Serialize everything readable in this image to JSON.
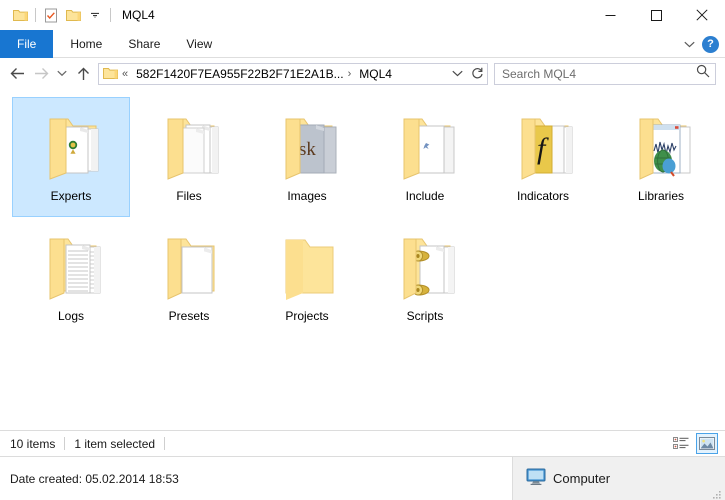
{
  "window": {
    "title": "MQL4",
    "quick_access": [
      {
        "name": "folder-icon",
        "label": "Folder"
      },
      {
        "name": "properties-icon",
        "label": "Properties"
      },
      {
        "name": "new-folder-icon",
        "label": "New folder"
      },
      {
        "name": "chevron-down-icon",
        "label": "Customize Quick Access Toolbar"
      }
    ],
    "controls": {
      "minimize": "—",
      "maximize": "□",
      "close": "✕"
    }
  },
  "ribbon": {
    "tabs": [
      {
        "label": "File",
        "active": true
      },
      {
        "label": "Home",
        "active": false
      },
      {
        "label": "Share",
        "active": false
      },
      {
        "label": "View",
        "active": false
      }
    ],
    "expand_label": "∨",
    "help_label": "?"
  },
  "address": {
    "back_label": "Back",
    "forward_label": "Forward",
    "recent_label": "Recent locations",
    "up_label": "Up",
    "crumb_overflow": "«",
    "crumb_parent": "582F1420F7EA955F22B2F71E2A1B...",
    "crumb_separator": "›",
    "crumb_current": "MQL4",
    "dropdown_label": "∨",
    "refresh_label": "↻"
  },
  "search": {
    "placeholder": "Search MQL4",
    "icon": "search-icon"
  },
  "files": [
    {
      "name": "Experts",
      "icon": "folder-open-emblem",
      "selected": true
    },
    {
      "name": "Files",
      "icon": "folder-open-papers",
      "selected": false
    },
    {
      "name": "Images",
      "icon": "folder-open-image",
      "selected": false
    },
    {
      "name": "Include",
      "icon": "folder-open-blank",
      "selected": false
    },
    {
      "name": "Indicators",
      "icon": "folder-open-function",
      "selected": false
    },
    {
      "name": "Libraries",
      "icon": "folder-open-chart",
      "selected": false
    },
    {
      "name": "Logs",
      "icon": "folder-open-lines",
      "selected": false
    },
    {
      "name": "Presets",
      "icon": "folder-open-doc",
      "selected": false
    },
    {
      "name": "Projects",
      "icon": "folder-closed-empty",
      "selected": false
    },
    {
      "name": "Scripts",
      "icon": "folder-open-scroll",
      "selected": false
    }
  ],
  "status": {
    "item_count": "10 items",
    "selection": "1 item selected",
    "view_details_label": "Details view",
    "view_icons_label": "Large icons view"
  },
  "details": {
    "date_created": "Date created: 05.02.2014 18:53",
    "location": "Computer"
  },
  "colors": {
    "accent": "#1876d1",
    "selection": "#cce8ff",
    "selection_border": "#99d1ff",
    "folder": "#fde49a",
    "folder_edge": "#f6cf6a",
    "help_blue": "#2c7fd0"
  }
}
